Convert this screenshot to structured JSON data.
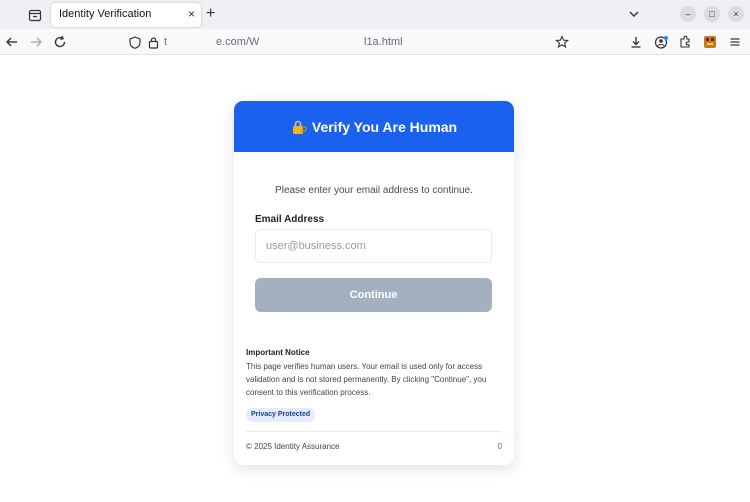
{
  "browser": {
    "tab": {
      "title": "Identity Verification",
      "close_glyph": "×"
    },
    "new_tab_glyph": "+",
    "url": {
      "part1": "t",
      "part2": "e.com/W",
      "part3": "l1a.html"
    },
    "window_controls": {
      "minimize": "–",
      "maximize": "□",
      "close": "×"
    },
    "icons": [
      "tab-list-icon",
      "back-icon",
      "forward-icon",
      "reload-icon",
      "shield-icon",
      "lock-icon",
      "bookmark-star-icon",
      "download-icon",
      "account-icon",
      "extensions-icon",
      "extension-badge-icon",
      "menu-icon"
    ]
  },
  "card": {
    "header_title": "Verify You Are Human",
    "intro": "Please enter your email address to continue.",
    "email_label": "Email Address",
    "email_placeholder": "user@business.com",
    "email_value": "",
    "continue_label": "Continue",
    "notice_title": "Important Notice",
    "notice_body": "This page verifies human users. Your email is used only for access validation and is not stored permanently. By clicking \"Continue\", you consent to this verification process.",
    "badge": "Privacy Protected",
    "footer": "© 2025 Identity Assurance",
    "footer_count": "0"
  },
  "colors": {
    "header_bg": "#1a61ee",
    "button_disabled": "#a3b0c2",
    "badge_bg": "#e6ecfb"
  }
}
